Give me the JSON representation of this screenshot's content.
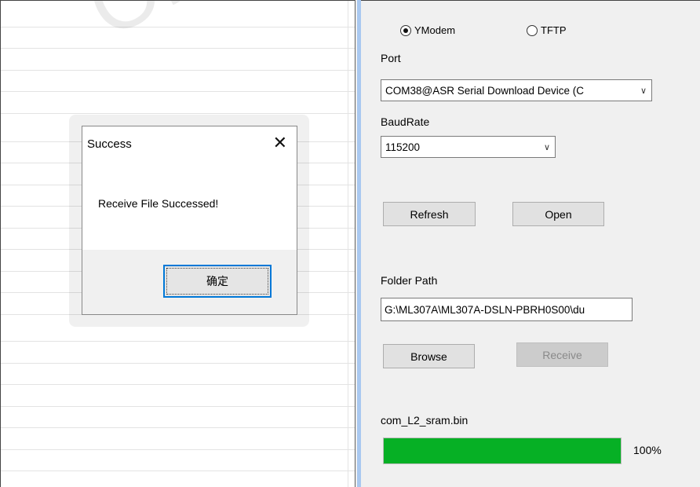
{
  "watermark": "OneMO",
  "dialog": {
    "title": "Success",
    "close_icon": "close-icon",
    "message": "Receive File Successed!",
    "ok_label": "确定"
  },
  "transfer": {
    "protocols": [
      {
        "label": "YModem",
        "selected": true
      },
      {
        "label": "TFTP",
        "selected": false
      }
    ],
    "port_label": "Port",
    "port_value": "COM38@ASR Serial Download Device (C",
    "baud_label": "BaudRate",
    "baud_value": "115200",
    "refresh_label": "Refresh",
    "open_label": "Open",
    "folder_label": "Folder Path",
    "folder_value": "G:\\ML307A\\ML307A-DSLN-PBRH0S00\\du",
    "browse_label": "Browse",
    "receive_label": "Receive",
    "file_name": "com_L2_sram.bin",
    "progress_fraction": 1.0,
    "progress_text": "100%"
  },
  "colors": {
    "progress": "#06b025",
    "focus": "#0078d7",
    "splitter_accent": "#a9c8f0"
  }
}
